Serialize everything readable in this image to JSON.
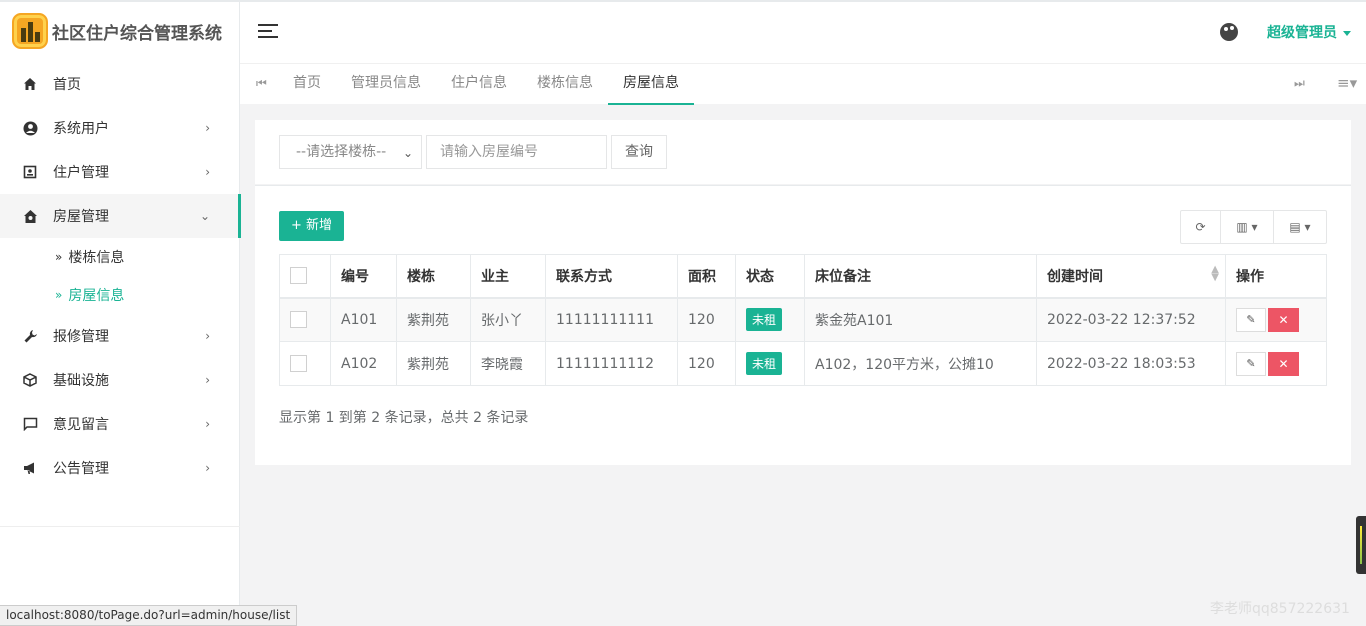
{
  "app": {
    "title": "社区住户综合管理系统",
    "user": "超级管理员"
  },
  "sidebar": {
    "items": [
      {
        "label": "首页",
        "icon": "home-icon"
      },
      {
        "label": "系统用户",
        "icon": "user-circle-icon"
      },
      {
        "label": "住户管理",
        "icon": "id-card-icon"
      },
      {
        "label": "房屋管理",
        "icon": "house-icon"
      },
      {
        "label": "报修管理",
        "icon": "wrench-icon"
      },
      {
        "label": "基础设施",
        "icon": "cube-icon"
      },
      {
        "label": "意见留言",
        "icon": "message-icon"
      },
      {
        "label": "公告管理",
        "icon": "megaphone-icon"
      }
    ],
    "subitems": [
      {
        "label": "楼栋信息"
      },
      {
        "label": "房屋信息"
      }
    ]
  },
  "tabs": [
    "首页",
    "管理员信息",
    "住户信息",
    "楼栋信息",
    "房屋信息"
  ],
  "search": {
    "select_value": "--请选择楼栋--",
    "input_placeholder": "请输入房屋编号",
    "query_label": "查询"
  },
  "table": {
    "add_label": "+ 新增",
    "headers": [
      "编号",
      "楼栋",
      "业主",
      "联系方式",
      "面积",
      "状态",
      "床位备注",
      "创建时间",
      "操作"
    ],
    "rows": [
      {
        "no": "A101",
        "building": "紫荆苑",
        "owner": "张小丫",
        "phone": "11111111111",
        "area": "120",
        "status": "未租",
        "remark": "紫金苑A101",
        "created": "2022-03-22 12:37:52"
      },
      {
        "no": "A102",
        "building": "紫荆苑",
        "owner": "李晓霞",
        "phone": "11111111112",
        "area": "120",
        "status": "未租",
        "remark": "A102，120平方米，公摊10",
        "created": "2022-03-22 18:03:53"
      }
    ],
    "pagination": "显示第 1 到第 2 条记录，总共 2 条记录"
  },
  "statusbar": "localhost:8080/toPage.do?url=admin/house/list",
  "watermark": "李老师qq857222631",
  "colors": {
    "accent": "#1ab394",
    "danger": "#ed5565"
  }
}
